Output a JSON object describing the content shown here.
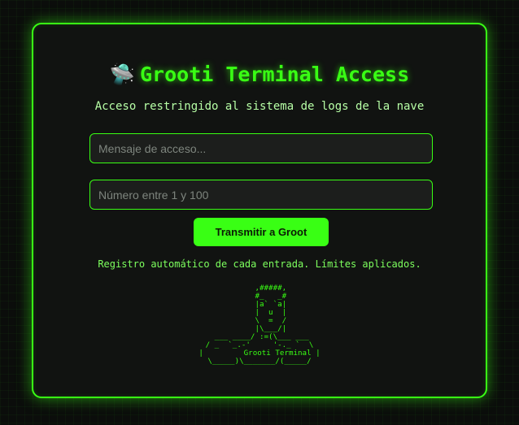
{
  "panel": {
    "title_icon": "🛸",
    "title": "Grooti Terminal Access",
    "subtitle": "Acceso restringido al sistema de logs de la nave"
  },
  "form": {
    "message_placeholder": "Mensaje de acceso...",
    "message_value": "",
    "number_placeholder": "Número entre 1 y 100",
    "number_value": "",
    "submit_label": "Transmitir a Groot"
  },
  "note": "Registro automático de cada entrada. Límites aplicados.",
  "ascii_art": "     ,#####,\n     #_   _#\n     |a` `a|\n     |  u  |\n     \\  =  /\n     |\\___/|\n ___ ____/ :=(\\___ ___\n/ _  `_.-'     '-._ `  \\\n|         Grooti Terminal |\n\\_____)\\_______/(_____/",
  "colors": {
    "accent": "#39ff14",
    "panel_bg": "#111311",
    "page_bg": "#0b0d0b"
  }
}
